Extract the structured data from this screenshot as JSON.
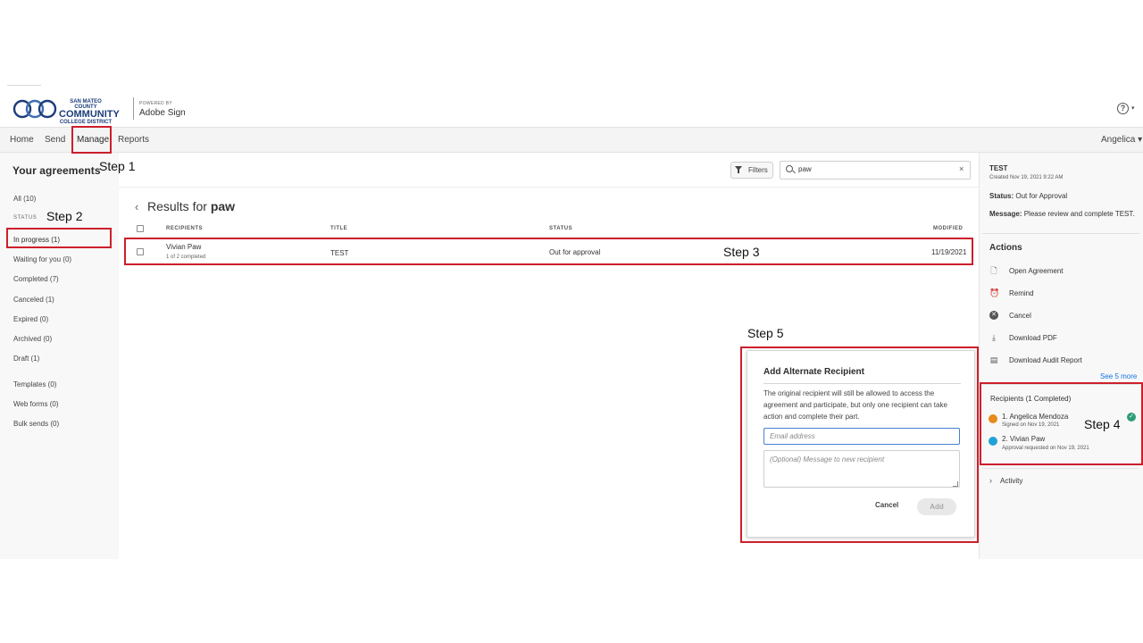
{
  "brand": {
    "logo_line1": "SAN MATEO COUNTY",
    "logo_line2": "COMMUNITY",
    "logo_line3": "COLLEGE DISTRICT",
    "powered_by": "POWERED BY",
    "product": "Adobe Sign"
  },
  "nav": {
    "items": [
      {
        "label": "Home"
      },
      {
        "label": "Send"
      },
      {
        "label": "Manage"
      },
      {
        "label": "Reports"
      }
    ],
    "user": "Angelica ▾",
    "help": "?"
  },
  "sidebar": {
    "title": "Your agreements",
    "all": "All (10)",
    "status_label": "STATUS",
    "status_items": [
      "In progress (1)",
      "Waiting for you (0)",
      "Completed (7)",
      "Canceled (1)",
      "Expired (0)",
      "Archived (0)",
      "Draft (1)"
    ],
    "other_items": [
      "Templates (0)",
      "Web forms (0)",
      "Bulk sends (0)"
    ]
  },
  "toolbar": {
    "filters_label": "Filters",
    "search_value": "paw",
    "search_clear": "×"
  },
  "results": {
    "prefix": "Results for",
    "query": "paw",
    "columns": [
      "RECIPIENTS",
      "TITLE",
      "STATUS",
      "MODIFIED"
    ],
    "rows": [
      {
        "recipient": "Vivian Paw",
        "progress": "1 of 2 completed",
        "title": "TEST",
        "status": "Out for approval",
        "modified": "11/19/2021"
      }
    ]
  },
  "details": {
    "name": "TEST",
    "created": "Created Nov 19, 2021 9:22 AM",
    "status_key": "Status:",
    "status_val": "Out for Approval",
    "message_key": "Message:",
    "message_val": "Please review and complete TEST.",
    "actions_title": "Actions",
    "actions": [
      {
        "label": "Open Agreement",
        "icon": "document-icon"
      },
      {
        "label": "Remind",
        "icon": "alarm-clock-icon"
      },
      {
        "label": "Cancel",
        "icon": "cancel-circle-icon"
      },
      {
        "label": "Download PDF",
        "icon": "download-pdf-icon"
      },
      {
        "label": "Download Audit Report",
        "icon": "audit-report-icon"
      }
    ],
    "see_more": "See 5 more",
    "recipients_title": "Recipients (1 Completed)",
    "recipients": [
      {
        "name": "1. Angelica Mendoza",
        "sub": "Signed on Nov 19, 2021",
        "color": "#e8891a"
      },
      {
        "name": "2. Vivian Paw",
        "sub": "Approval requested on Nov 19, 2021",
        "color": "#1fa3d6"
      }
    ],
    "activity": "Activity"
  },
  "dialog": {
    "title": "Add Alternate Recipient",
    "body": "The original recipient will still be allowed to access the agreement and participate, but only one recipient can take action and complete their part.",
    "email_placeholder": "Email address",
    "message_placeholder": "(Optional) Message to new recipient",
    "cancel": "Cancel",
    "add": "Add"
  },
  "annotations": {
    "step1": "Step 1",
    "step2": "Step 2",
    "step3": "Step 3",
    "step4": "Step 4",
    "step5": "Step 5"
  },
  "colors": {
    "annotation": "#cc1f2b",
    "link": "#1473e6",
    "success": "#2d9d78"
  }
}
